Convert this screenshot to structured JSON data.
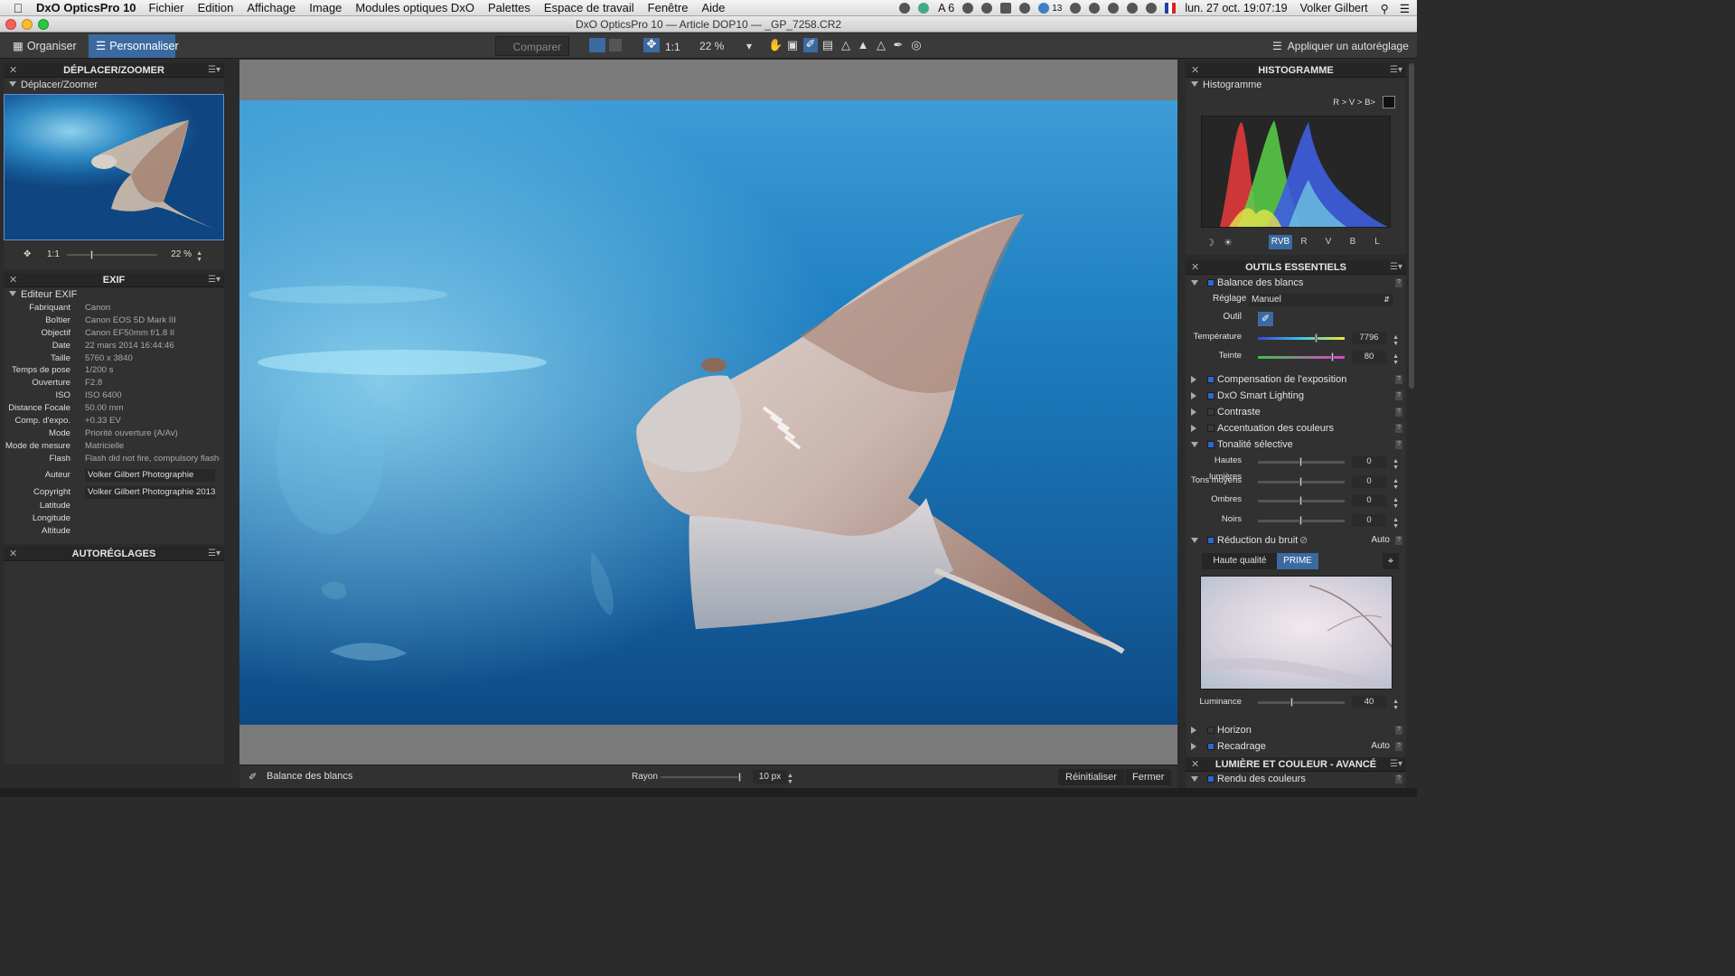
{
  "menubar": {
    "app_name": "DxO OpticsPro 10",
    "items": [
      "Fichier",
      "Edition",
      "Affichage",
      "Image",
      "Modules optiques DxO",
      "Palettes",
      "Espace de travail",
      "Fenêtre",
      "Aide"
    ],
    "status_a6": "A 6",
    "status_13": "13",
    "datetime": "lun. 27 oct.  19:07:19",
    "user": "Volker Gilbert"
  },
  "window": {
    "title": "DxO OpticsPro 10 — Article DOP10 — _GP_7258.CR2"
  },
  "toolbar": {
    "organize": "Organiser",
    "customize": "Personnaliser",
    "compare": "Comparer",
    "one_to_one": "1:1",
    "zoom": "22 %",
    "apply_preset": "Appliquer un autoréglage"
  },
  "left": {
    "nav": {
      "title": "DÉPLACER/ZOOMER",
      "sub": "Déplacer/Zoomer",
      "one_to_one": "1:1",
      "zoom": "22 %"
    },
    "exif": {
      "title": "EXIF",
      "sub": "Editeur EXIF",
      "rows": [
        {
          "k": "Fabriquant",
          "v": "Canon"
        },
        {
          "k": "Boîtier",
          "v": "Canon EOS 5D Mark III"
        },
        {
          "k": "Objectif",
          "v": "Canon EF50mm f/1.8 II"
        },
        {
          "k": "Date",
          "v": "22 mars 2014 16:44:46"
        },
        {
          "k": "Taille",
          "v": "5760 x 3840"
        },
        {
          "k": "Temps de pose",
          "v": "1/200 s"
        },
        {
          "k": "Ouverture",
          "v": "F2.8"
        },
        {
          "k": "ISO",
          "v": "ISO 6400"
        },
        {
          "k": "Distance Focale",
          "v": "50.00 mm"
        },
        {
          "k": "Comp. d'expo.",
          "v": "+0.33 EV"
        },
        {
          "k": "Mode",
          "v": "Priorité ouverture (A/Av)"
        },
        {
          "k": "Mode de mesure",
          "v": "Matricielle"
        },
        {
          "k": "Flash",
          "v": "Flash did not fire, compulsory flash···"
        }
      ],
      "author_label": "Auteur",
      "author": "Volker Gilbert Photographie",
      "copyright_label": "Copyright",
      "copyright": "Volker Gilbert Photographie 2013",
      "latitude": "Latitude",
      "longitude": "Longitude",
      "altitude": "Altitude"
    },
    "presets": {
      "title": "AUTORÉGLAGES"
    }
  },
  "bottom": {
    "tool": "Balance des blancs",
    "radius_label": "Rayon",
    "radius_value": "10 px",
    "reset": "Réinitialiser",
    "close": "Fermer"
  },
  "right": {
    "hist": {
      "title": "HISTOGRAMME",
      "sub": "Histogramme",
      "rgb_label": "R > V > B>",
      "channels": [
        "RVB",
        "R",
        "V",
        "B",
        "L"
      ]
    },
    "essentials": {
      "title": "OUTILS ESSENTIELS",
      "wb": {
        "label": "Balance des blancs",
        "setting_label": "Réglage",
        "setting": "Manuel",
        "tool_label": "Outil",
        "temp_label": "Température",
        "temp": "7796",
        "tint_label": "Teinte",
        "tint": "80"
      },
      "tools": [
        "Compensation de l'exposition",
        "DxO Smart Lighting",
        "Contraste",
        "Accentuation des couleurs"
      ],
      "tonal": {
        "label": "Tonalité sélective",
        "rows": [
          {
            "k": "Hautes lumières",
            "v": "0"
          },
          {
            "k": "Tons moyens",
            "v": "0"
          },
          {
            "k": "Ombres",
            "v": "0"
          },
          {
            "k": "Noirs",
            "v": "0"
          }
        ]
      },
      "noise": {
        "label": "Réduction du bruit",
        "auto": "Auto",
        "hq": "Haute qualité",
        "prime": "PRIME",
        "lum_label": "Luminance",
        "lum": "40"
      },
      "horizon": "Horizon",
      "crop": "Recadrage",
      "crop_auto": "Auto"
    },
    "advanced": {
      "title": "LUMIÈRE ET COULEUR - AVANCÉ",
      "render": "Rendu des couleurs"
    }
  }
}
